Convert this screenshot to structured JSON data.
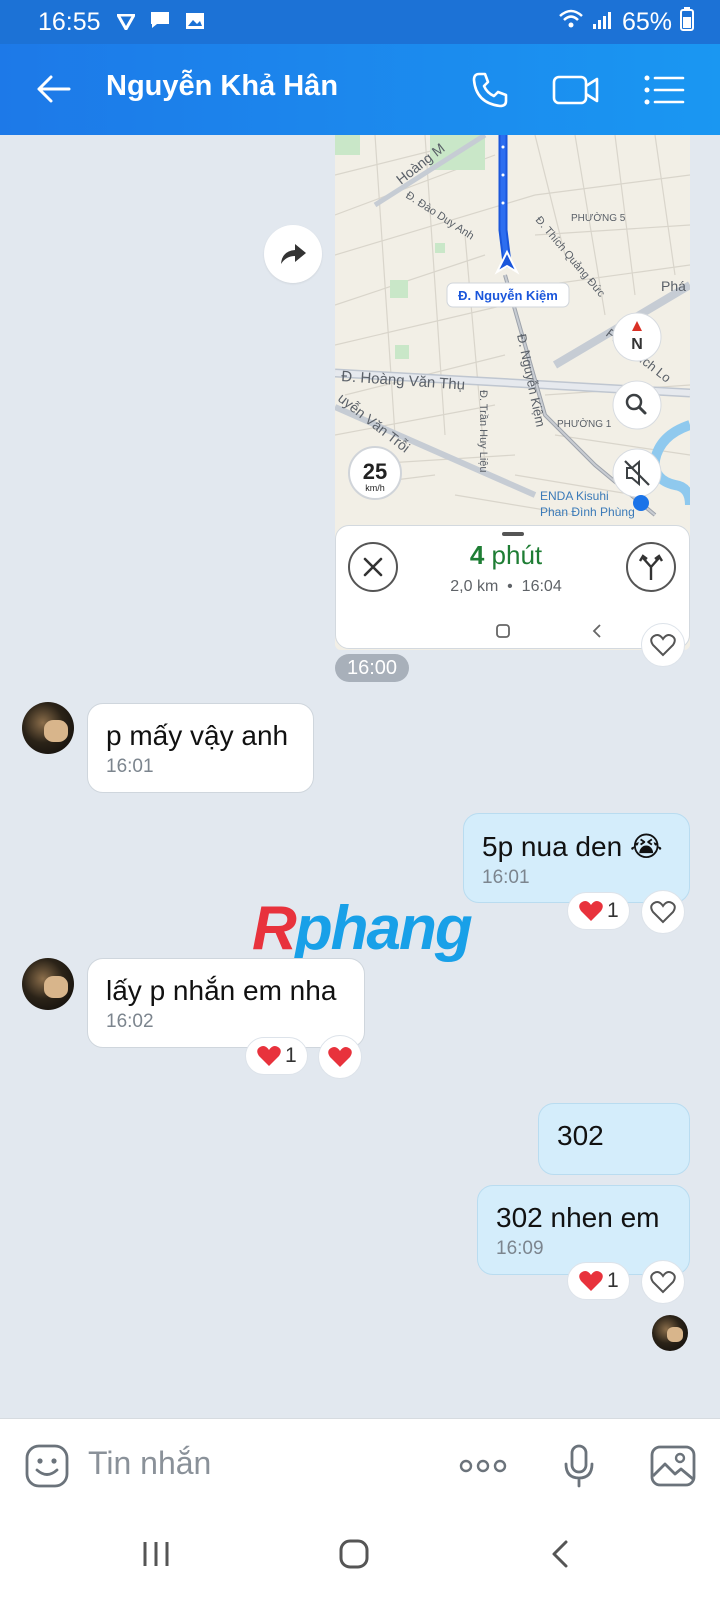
{
  "status_bar": {
    "time": "16:55",
    "battery": "65%"
  },
  "header": {
    "contact_name": "Nguyễn Khả Hân"
  },
  "map_share": {
    "street_labels": [
      "Hoàng M",
      "Đ. Đào Duy Anh",
      "PHƯỜNG 5",
      "Đ. Thích Quảng Đức",
      "Đ. Nguyễn Kiệm",
      "Phan Xích Lo",
      "Đ. Hoàng Văn Thụ",
      "Đ. Trần Huy Liệu",
      "PHƯỜNG 1",
      "uyễn Văn Trỗi",
      "ENDA Kisuhi",
      "Phan Đình Phùng",
      "Phá"
    ],
    "speed_limit": "25",
    "speed_unit": "km/h",
    "compass_label": "N",
    "eta_value": "4",
    "eta_unit": "phút",
    "distance": "2,0 km",
    "arrival": "16:04",
    "sent_time": "16:00"
  },
  "messages": [
    {
      "id": "m1",
      "direction": "in",
      "text": "p mấy vậy anh",
      "time": "16:01"
    },
    {
      "id": "m2",
      "direction": "out",
      "text": "5p nua den",
      "emoji": "😭",
      "time": "16:01",
      "reaction_count": "1"
    },
    {
      "id": "m3",
      "direction": "in",
      "text": "lấy p nhắn em nha",
      "time": "16:02",
      "reaction_count": "1"
    },
    {
      "id": "m4",
      "direction": "out",
      "text": "302"
    },
    {
      "id": "m5",
      "direction": "out",
      "text": "302 nhen em",
      "time": "16:09",
      "reaction_count": "1"
    }
  ],
  "watermark": {
    "part1": "R",
    "part2": "phang"
  },
  "composer": {
    "placeholder": "Tin nhắn"
  },
  "colors": {
    "header_start": "#1d79e8",
    "header_end": "#1a97f2",
    "chat_background": "#e2e8ef",
    "outgoing_bubble": "#d4edfb",
    "incoming_bubble": "#ffffff",
    "heart": "#e8323c",
    "eta_green": "#1e7d34"
  }
}
